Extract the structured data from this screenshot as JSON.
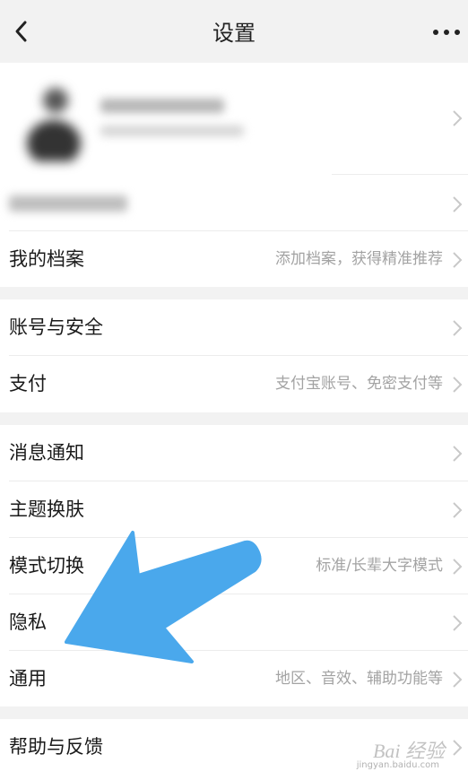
{
  "header": {
    "title": "设置",
    "back_icon": "chevron-left-icon",
    "more_icon": "more-dots-icon"
  },
  "groups": [
    {
      "rows": [
        {
          "label": "我的档案",
          "hint": "添加档案，获得精准推荐"
        }
      ]
    },
    {
      "rows": [
        {
          "label": "账号与安全",
          "hint": ""
        },
        {
          "label": "支付",
          "hint": "支付宝账号、免密支付等"
        }
      ]
    },
    {
      "rows": [
        {
          "label": "消息通知",
          "hint": ""
        },
        {
          "label": "主题换肤",
          "hint": ""
        },
        {
          "label": "模式切换",
          "hint": "标准/长辈大字模式"
        },
        {
          "label": "隐私",
          "hint": ""
        },
        {
          "label": "通用",
          "hint": "地区、音效、辅助功能等"
        }
      ]
    },
    {
      "rows": [
        {
          "label": "帮助与反馈",
          "hint": ""
        }
      ]
    }
  ],
  "annotation": {
    "arrow_color": "#4aa8ec",
    "arrow_target": "隐私"
  },
  "watermark": {
    "text": "Bai 经验",
    "url": "jingyan.baidu.com"
  },
  "colors": {
    "background": "#f2f2f2",
    "card": "#ffffff",
    "hint": "#a3a3a3",
    "label": "#1a1a1a"
  }
}
